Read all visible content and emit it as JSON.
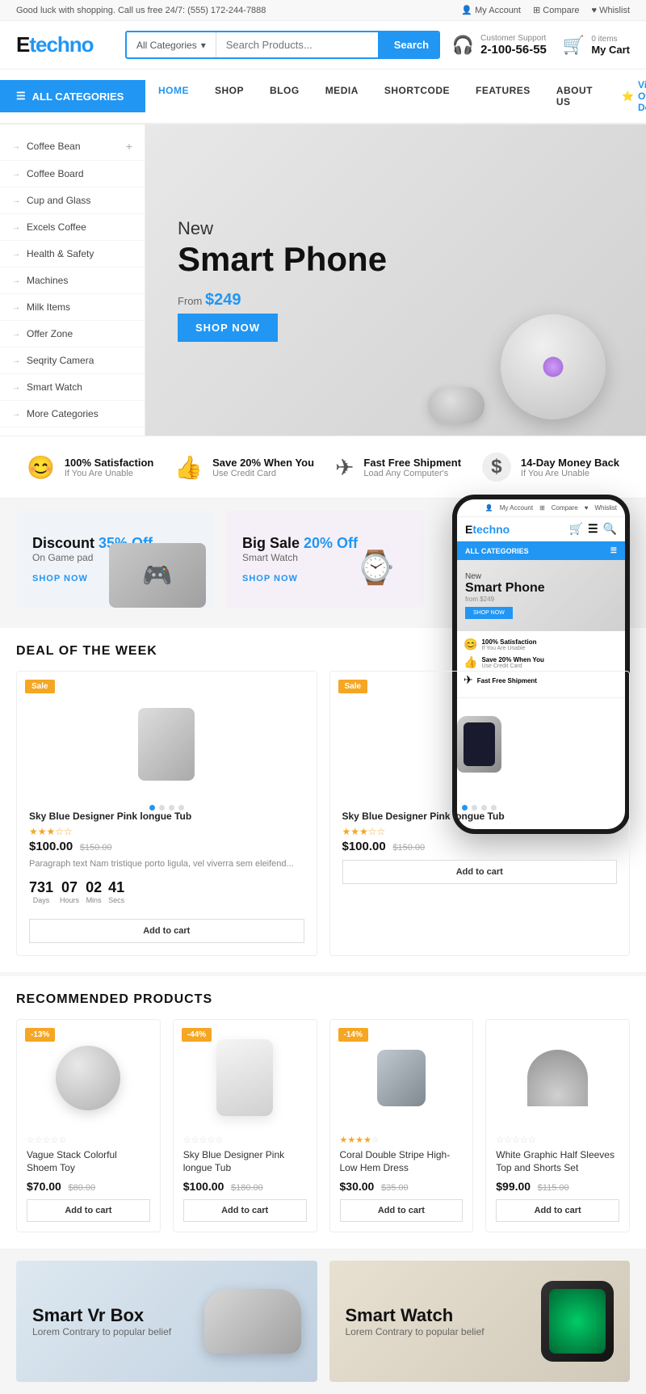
{
  "topbar": {
    "message": "Good luck with shopping. Call us free 24/7: (555) 172-244-7888",
    "links": [
      "My Account",
      "Compare",
      "Whislist"
    ]
  },
  "header": {
    "logo": "Etechno",
    "search": {
      "category_label": "All Categories",
      "placeholder": "Search Products...",
      "button": "Search"
    },
    "support": {
      "label": "Customer Support",
      "number": "2-100-56-55"
    },
    "cart": {
      "items": "0 items",
      "label": "My Cart"
    }
  },
  "nav": {
    "all_categories": "ALL CATEGORIES",
    "links": [
      "HOME",
      "SHOP",
      "BLOG",
      "MEDIA",
      "SHORTCODE",
      "FEATURES",
      "ABOUT US"
    ],
    "offer": "View Offer Deals"
  },
  "sidebar": {
    "items": [
      "Coffee Bean",
      "Coffee Board",
      "Cup and Glass",
      "Excels Coffee",
      "Health & Safety",
      "Machines",
      "Milk Items",
      "Offer Zone",
      "Seqrity Camera",
      "Smart Watch",
      "More Categories"
    ]
  },
  "hero": {
    "subtitle": "New",
    "title": "Smart Phone",
    "from_label": "From",
    "price": "$249",
    "button": "SHOP NOW"
  },
  "features": [
    {
      "icon": "😊",
      "title": "100% Satisfaction",
      "desc": "If You Are Unable"
    },
    {
      "icon": "👍",
      "title": "Save 20% When You",
      "desc": "Use Credit Card"
    },
    {
      "icon": "✈",
      "title": "Fast Free Shipment",
      "desc": "Load Any Computer's"
    },
    {
      "icon": "$",
      "title": "14-Day Money Back",
      "desc": "If You Are Unable"
    }
  ],
  "promos": [
    {
      "discount": "Discount 35% Off",
      "subtitle": "On Game pad",
      "link": "SHOP NOW"
    },
    {
      "discount": "Big Sale 20% Off",
      "subtitle": "Smart Watch",
      "link": "SHOP NOW"
    }
  ],
  "deals": {
    "section_title": "DEAL OF THE WEEK",
    "items": [
      {
        "badge": "Sale",
        "title": "Sky Blue Designer Pink longue Tub",
        "stars": 3,
        "price": "$100.00",
        "old_price": "$150.00",
        "desc": "Paragraph text Nam tristique porto ligula, vel viverra sem eleifend...",
        "countdown": {
          "days": "731",
          "hours": "07",
          "mins": "02",
          "secs": "41"
        },
        "button": "Add to cart"
      },
      {
        "badge": "Sale",
        "title": "Sky Blue Designer Pink longue Tub",
        "stars": 3,
        "price": "$100.00",
        "old_price": "$150.00",
        "button": "Add to cart"
      }
    ]
  },
  "recommended": {
    "section_title": "RECOMMENDED PRODUCTS",
    "products": [
      {
        "discount": "-13%",
        "title": "Vague Stack Colorful Shoem Toy",
        "stars": 0,
        "price": "$70.00",
        "old_price": "$80.00",
        "button": "Add to cart"
      },
      {
        "discount": "-44%",
        "title": "Sky Blue Designer Pink longue Tub",
        "stars": 0,
        "price": "$100.00",
        "old_price": "$180.00",
        "button": "Add to cart"
      },
      {
        "discount": "-14%",
        "title": "Coral Double Stripe High-Low Hem Dress",
        "stars": 4,
        "price": "$30.00",
        "old_price": "$35.00",
        "button": "Add to cart"
      },
      {
        "discount": "",
        "title": "White Graphic Half Sleeves Top and Shorts Set",
        "stars": 0,
        "price": "$99.00",
        "old_price": "$115.00",
        "button": "Add to cart"
      }
    ]
  },
  "bottom_banners": [
    {
      "title": "Smart Vr Box",
      "desc": "Lorem Contrary to popular belief"
    },
    {
      "title": "Smart Watch",
      "desc": "Lorem Contrary to popular belief"
    }
  ],
  "mobile": {
    "top_links": [
      "My Account",
      "Compare",
      "Whislist"
    ],
    "logo": "Etechno",
    "nav_label": "ALL CATEGORIES",
    "hero_subtitle": "New",
    "hero_title": "Smart Phone",
    "hero_from": "from $249",
    "hero_button": "SHOP NOW",
    "features": [
      {
        "icon": "😊",
        "title": "100% Satisfaction",
        "desc": "If You Are Unable"
      },
      {
        "icon": "👍",
        "title": "Save 20% When You",
        "desc": "Use Credit Card"
      },
      {
        "icon": "✈",
        "title": "Fast Free Shipment",
        "desc": ""
      }
    ]
  }
}
